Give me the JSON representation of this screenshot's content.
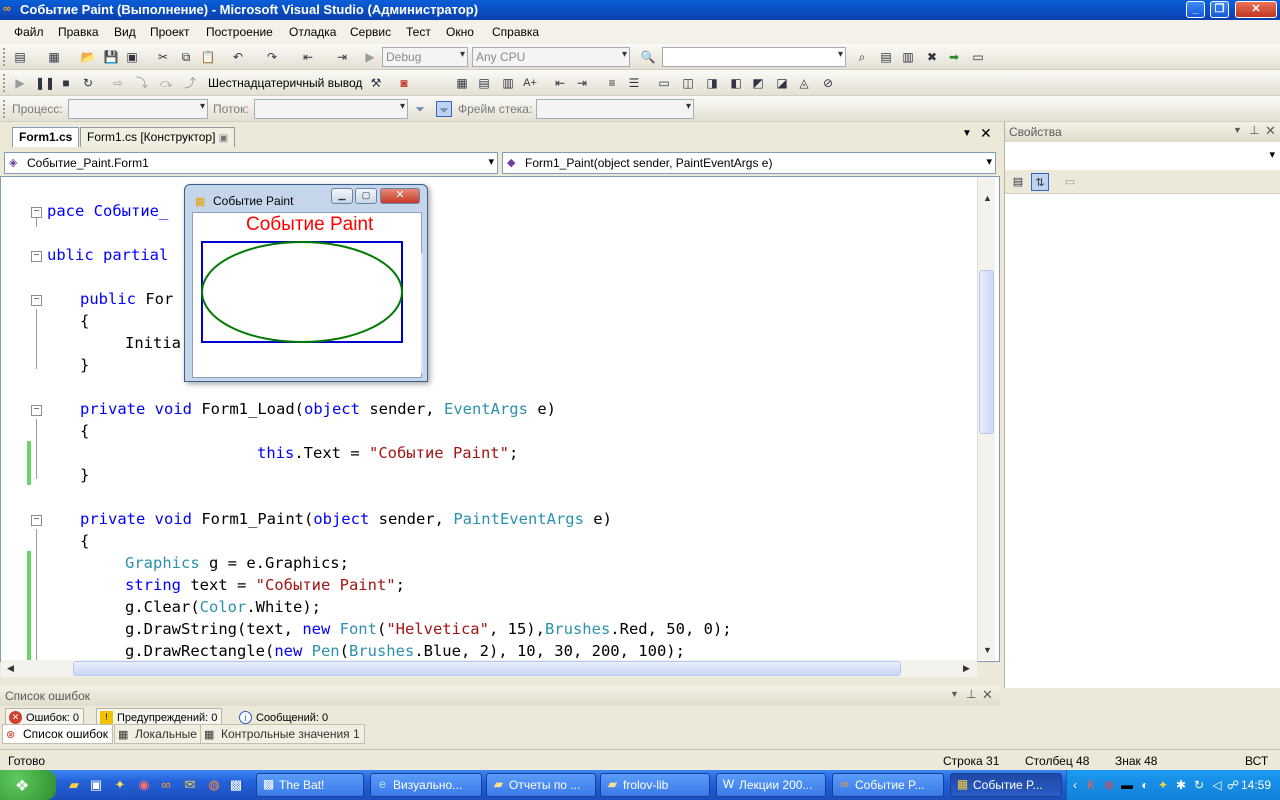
{
  "window": {
    "title": "Событие Paint (Выполнение) - Microsoft Visual Studio (Администратор)",
    "min_glyph": "_",
    "max_glyph": "❐",
    "close_glyph": "✕"
  },
  "menu": [
    "Файл",
    "Правка",
    "Вид",
    "Проект",
    "Построение",
    "Отладка",
    "Сервис",
    "Тест",
    "Окно",
    "Справка"
  ],
  "toolbar1": {
    "config": "Debug",
    "platform": "Any CPU"
  },
  "toolbar2": {
    "hex_display": "Шестнадцатеричный вывод"
  },
  "toolbar3": {
    "process_label": "Процесс:",
    "thread_label": "Поток:",
    "stack_label": "Фрейм стека:"
  },
  "tabs": {
    "active": "Form1.cs",
    "designer": "Form1.cs [Конструктор]"
  },
  "nav": {
    "class": "Событие_Paint.Form1",
    "member": "Form1_Paint(object sender, PaintEventArgs e)"
  },
  "code": {
    "l1": "pace Событие_",
    "l2a": "ublic ",
    "l2b": "partial",
    "l3a": "public ",
    "l3b": "For",
    "l4": "{",
    "l5": "Initia",
    "l6": "}",
    "l7a": "private void ",
    "l7b": "Form1_Load(",
    "l7c": "object",
    "l7d": " sender, ",
    "l7e": "EventArgs",
    "l7f": " e)",
    "l8": "{",
    "l9a": "this",
    "l9b": ".Text = ",
    "l9c": "\"Событие Paint\"",
    "l9d": ";",
    "l10": "}",
    "l11a": "private void ",
    "l11b": "Form1_Paint(",
    "l11c": "object",
    "l11d": " sender, ",
    "l11e": "PaintEventArgs",
    "l11f": " e)",
    "l12": "{",
    "l13a": "Graphics",
    "l13b": " g = e.Graphics;",
    "l14a": "string",
    "l14b": " text = ",
    "l14c": "\"Событие Paint\"",
    "l14d": ";",
    "l15a": "g.Clear(",
    "l15b": "Color",
    "l15c": ".White);",
    "l16a": "g.DrawString(text, ",
    "l16b": "new ",
    "l16c": "Font",
    "l16d": "(",
    "l16e": "\"Helvetica\"",
    "l16f": ", 15),",
    "l16g": "Brushes",
    "l16h": ".Red, 50, 0);",
    "l17a": "g.DrawRectangle(",
    "l17b": "new ",
    "l17c": "Pen",
    "l17d": "(",
    "l17e": "Brushes",
    "l17f": ".Blue, 2), 10, 30, 200, 100);"
  },
  "form": {
    "title": "Событие Paint",
    "paint_text": "Событие Paint",
    "rect_color": "#0000cc",
    "ellipse_color": "#007a00"
  },
  "properties": {
    "title": "Свойства"
  },
  "errors": {
    "title": "Список ошибок",
    "errors_btn": "Ошибок: 0",
    "warnings_btn": "Предупреждений: 0",
    "messages_btn": "Сообщений: 0"
  },
  "bottom_tabs": [
    "Список ошибок",
    "Локальные",
    "Контрольные значения 1"
  ],
  "status": {
    "ready": "Готово",
    "row": "Строка 31",
    "col": "Столбец 48",
    "char": "Знак 48",
    "mode": "ВСТ"
  },
  "taskbar": {
    "tasks": [
      "The Bat!",
      "Визуально...",
      "Отчеты по ...",
      "frolov-lib",
      "Лекции 200...",
      "Событие P...",
      "Событие P..."
    ],
    "clock": "14:59"
  },
  "colors": {
    "keyword": "#0000ff",
    "type": "#2b91af",
    "string": "#a31515"
  }
}
